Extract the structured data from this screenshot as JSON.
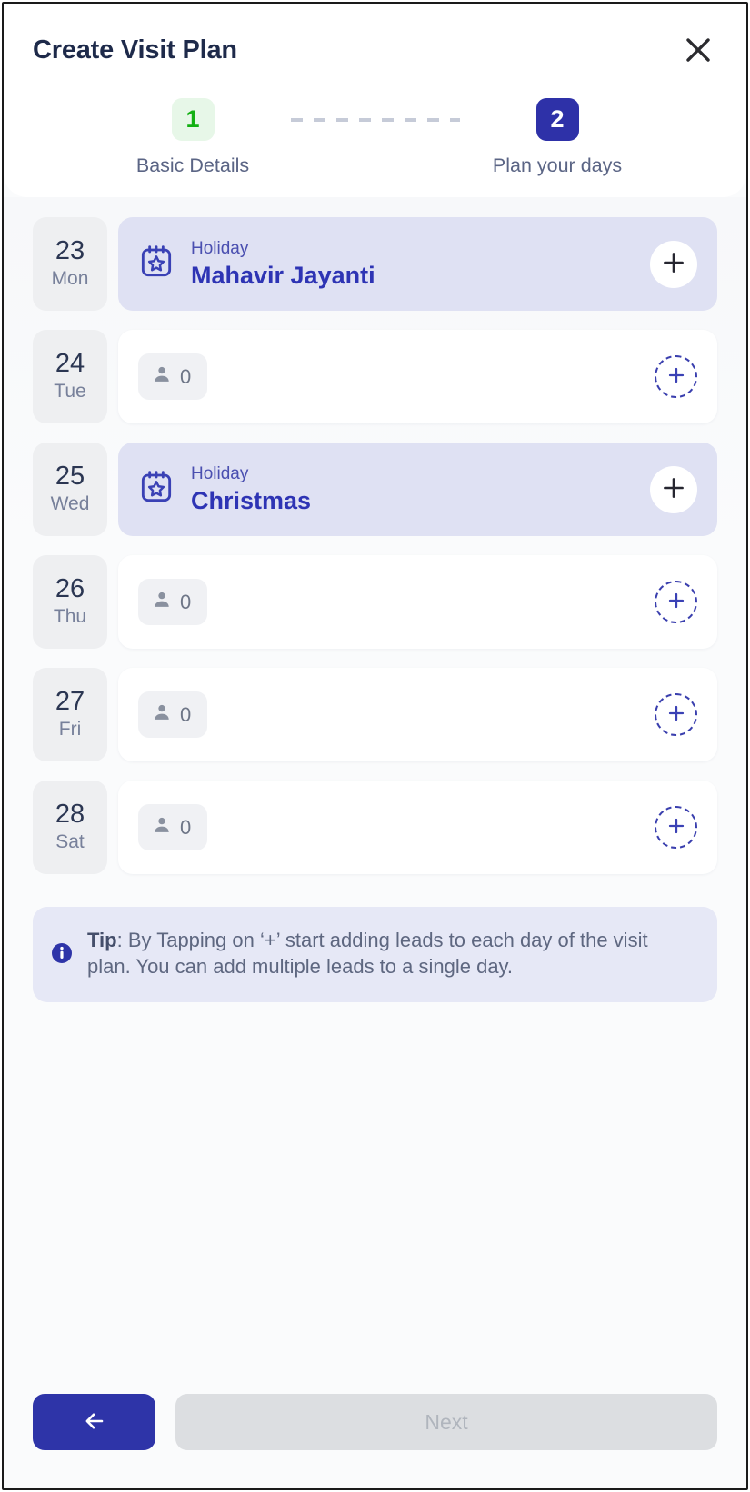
{
  "header": {
    "title": "Create Visit Plan",
    "close_icon": "close-icon"
  },
  "stepper": {
    "steps": [
      {
        "number": "1",
        "label": "Basic Details",
        "state": "done",
        "color": "#13b013",
        "bg": "#e7f7e8"
      },
      {
        "number": "2",
        "label": "Plan your days",
        "state": "active",
        "color": "#ffffff",
        "bg": "#2e31a8"
      }
    ]
  },
  "days": [
    {
      "date": "23",
      "dow": "Mon",
      "type": "holiday",
      "kicker": "Holiday",
      "name": "Mahavir Jayanti",
      "add_label": "+"
    },
    {
      "date": "24",
      "dow": "Tue",
      "type": "empty",
      "lead_count": "0",
      "add_label": "+"
    },
    {
      "date": "25",
      "dow": "Wed",
      "type": "holiday",
      "kicker": "Holiday",
      "name": "Christmas",
      "add_label": "+"
    },
    {
      "date": "26",
      "dow": "Thu",
      "type": "empty",
      "lead_count": "0",
      "add_label": "+"
    },
    {
      "date": "27",
      "dow": "Fri",
      "type": "empty",
      "lead_count": "0",
      "add_label": "+"
    },
    {
      "date": "28",
      "dow": "Sat",
      "type": "empty",
      "lead_count": "0",
      "add_label": "+"
    }
  ],
  "tip": {
    "icon": "info-icon",
    "label": "Tip",
    "body": ": By Tapping on ‘+’ start adding leads to each day of the visit plan. You can add multiple leads to a single day."
  },
  "footer": {
    "back_icon": "arrow-left-icon",
    "next_label": "Next"
  },
  "colors": {
    "accent": "#2e34a8",
    "holiday_bg": "#dfe1f3",
    "holiday_text": "#2e34b4",
    "step_done": "#13b013",
    "tip_bg": "#e6e8f6",
    "page_bg": "#fafbfc"
  }
}
